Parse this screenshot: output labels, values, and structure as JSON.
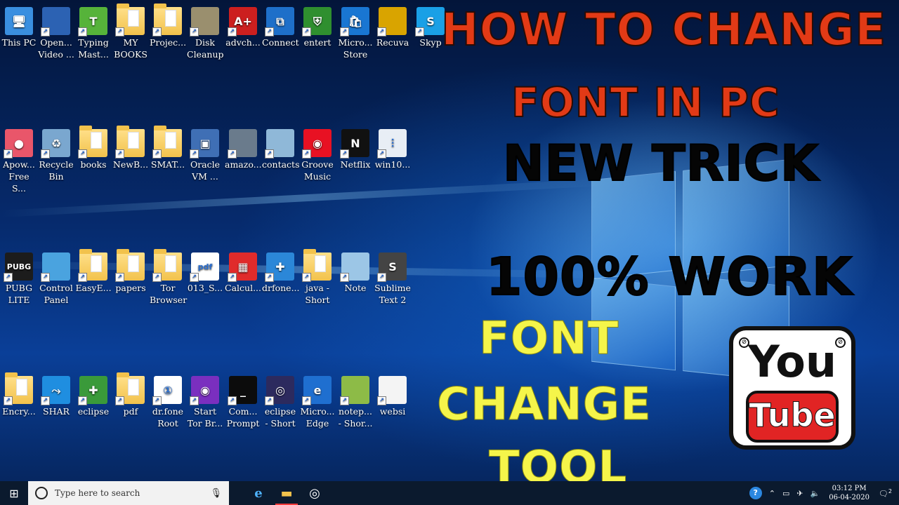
{
  "desktop_icons": [
    {
      "label": "This PC",
      "kind": "pc",
      "color": "#3a8fe0"
    },
    {
      "label": "Open... Video ...",
      "kind": "app",
      "color": "#2c62b3"
    },
    {
      "label": "Typing Mast...",
      "kind": "app",
      "color": "#56b33a",
      "glyph": "T"
    },
    {
      "label": "MY BOOKS",
      "kind": "folder"
    },
    {
      "label": "Projec...",
      "kind": "folder"
    },
    {
      "label": "Disk Cleanup",
      "kind": "app",
      "color": "#9a8f6e"
    },
    {
      "label": "advch...",
      "kind": "app",
      "color": "#cc1f1f",
      "glyph": "A+"
    },
    {
      "label": "Connect",
      "kind": "app",
      "color": "#1e6fc9",
      "glyph": "⧉"
    },
    {
      "label": "entert",
      "kind": "app",
      "color": "#2f8f2f",
      "glyph": "⛨"
    },
    {
      "label": "Micro... Store",
      "kind": "app",
      "color": "#1976d2",
      "glyph": "🛍"
    },
    {
      "label": "Recuva",
      "kind": "app",
      "color": "#d9a400"
    },
    {
      "label": "Skyp",
      "kind": "app",
      "color": "#1aa0e6",
      "glyph": "S"
    },
    {
      "label": "Apow... Free S...",
      "kind": "app",
      "color": "#e9566a",
      "glyph": "●"
    },
    {
      "label": "Recycle Bin",
      "kind": "app",
      "color": "#7aa7cf",
      "glyph": "♻"
    },
    {
      "label": "books",
      "kind": "folder"
    },
    {
      "label": "NewB...",
      "kind": "folder"
    },
    {
      "label": "SMAT...",
      "kind": "folder"
    },
    {
      "label": "Oracle VM ...",
      "kind": "app",
      "color": "#3f6fb5",
      "glyph": "▣"
    },
    {
      "label": "amazo...",
      "kind": "app",
      "color": "#6a7b8c"
    },
    {
      "label": "contacts",
      "kind": "app",
      "color": "#8fb8d8"
    },
    {
      "label": "Groove Music",
      "kind": "app",
      "color": "#e81123",
      "glyph": "◉"
    },
    {
      "label": "Netflix",
      "kind": "app",
      "color": "#111111",
      "glyph": "N"
    },
    {
      "label": "win10...",
      "kind": "app",
      "color": "#e8eef5",
      "glyph": "⫶"
    },
    {
      "label": "PUBG LITE",
      "kind": "app",
      "color": "#1c1c1c",
      "glyph": "PUBG"
    },
    {
      "label": "Control Panel",
      "kind": "app",
      "color": "#4aa3df"
    },
    {
      "label": "EasyE...",
      "kind": "folder"
    },
    {
      "label": "papers",
      "kind": "folder"
    },
    {
      "label": "Tor Browser",
      "kind": "folder"
    },
    {
      "label": "013_S...",
      "kind": "app",
      "color": "#ffffff",
      "glyph": "pdf"
    },
    {
      "label": "Calcul...",
      "kind": "app",
      "color": "#e02b2b",
      "glyph": "▦"
    },
    {
      "label": "drfone...",
      "kind": "app",
      "color": "#2b87d8",
      "glyph": "✚"
    },
    {
      "label": "java - Short",
      "kind": "folder"
    },
    {
      "label": "Note",
      "kind": "app",
      "color": "#9cc6e6"
    },
    {
      "label": "Sublime Text 2",
      "kind": "app",
      "color": "#444444",
      "glyph": "S"
    },
    {
      "label": "Encry...",
      "kind": "folder"
    },
    {
      "label": "SHAR",
      "kind": "app",
      "color": "#1f8ee0",
      "glyph": "⤳"
    },
    {
      "label": "eclipse",
      "kind": "app",
      "color": "#3a9a3a",
      "glyph": "✚"
    },
    {
      "label": "pdf",
      "kind": "folder"
    },
    {
      "label": "dr.fone Root",
      "kind": "app",
      "color": "#ffffff",
      "glyph": "①"
    },
    {
      "label": "Start Tor Br...",
      "kind": "app",
      "color": "#7a2fbf",
      "glyph": "◉"
    },
    {
      "label": "Com... Prompt",
      "kind": "app",
      "color": "#0c0c0c",
      "glyph": "_"
    },
    {
      "label": "eclipse - Short",
      "kind": "app",
      "color": "#2c2a5e",
      "glyph": "◎"
    },
    {
      "label": "Micro... Edge",
      "kind": "app",
      "color": "#1f6fd0",
      "glyph": "e"
    },
    {
      "label": "notep... - Shor...",
      "kind": "app",
      "color": "#8dbb47"
    },
    {
      "label": "websi",
      "kind": "app",
      "color": "#f4f4f4"
    }
  ],
  "overlay": {
    "line1": "HOW TO CHANGE",
    "line2": "FONT IN PC",
    "line3": "NEW TRICK",
    "line4": "100% WORK",
    "line5": "FONT",
    "line6": "CHANGE",
    "line7": "TOOL"
  },
  "youtube_logo": {
    "top": "You",
    "bottom": "Tube"
  },
  "taskbar": {
    "search_placeholder": "Type here to search",
    "clock_time": "03:12 PM",
    "clock_date": "06-04-2020",
    "notification_count": "2"
  }
}
